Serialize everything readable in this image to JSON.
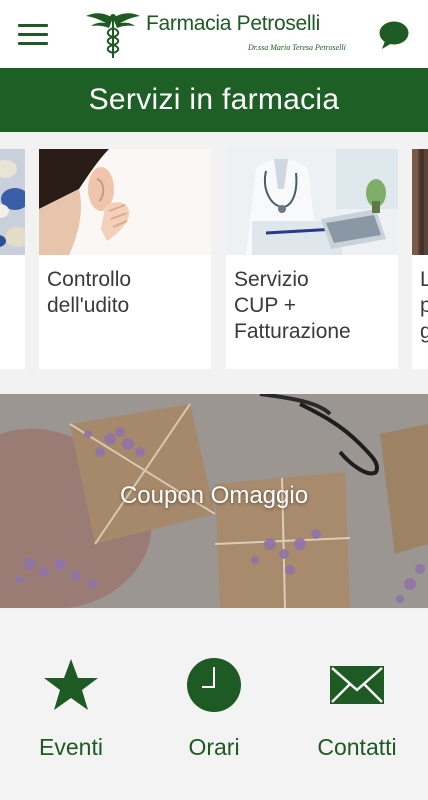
{
  "header": {
    "brand_name": "Farmacia Petroselli",
    "brand_sub": "Dr.ssa Maria Teresa Petroselli",
    "menu_icon": "hamburger-menu-icon",
    "chat_icon": "chat-bubble-icon"
  },
  "section": {
    "title": "Servizi in farmacia"
  },
  "services": [
    {
      "label": "",
      "image": "pills-photo"
    },
    {
      "label": "Controllo\ndell'udito",
      "image": "ear-check-photo"
    },
    {
      "label": "Servizio\nCUP +\nFatturazione",
      "image": "doctor-desk-photo"
    },
    {
      "label": "L\np\ng",
      "image": "wood-photo"
    }
  ],
  "coupon": {
    "title": "Coupon Omaggio"
  },
  "bottom_nav": [
    {
      "label": "Eventi",
      "icon": "star-icon"
    },
    {
      "label": "Orari",
      "icon": "clock-icon"
    },
    {
      "label": "Contatti",
      "icon": "envelope-icon"
    }
  ],
  "colors": {
    "brand_green": "#1e5f26",
    "text_dark": "#3a3a3a",
    "background": "#f2f2f2"
  }
}
